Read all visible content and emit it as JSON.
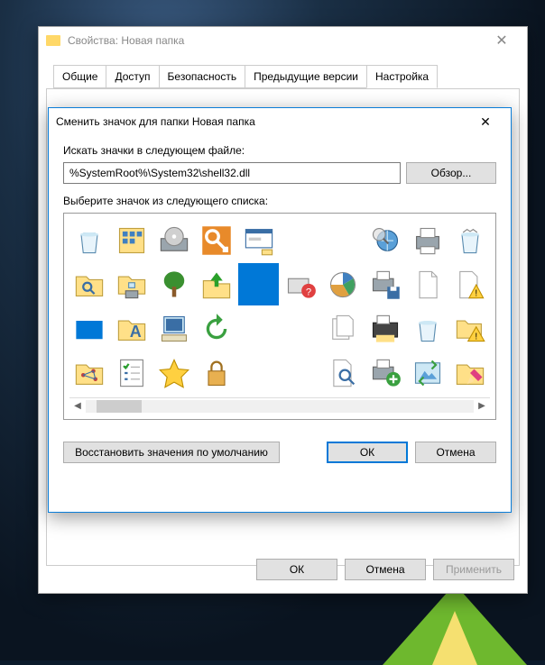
{
  "parent": {
    "title": "Свойства: Новая папка",
    "tabs": [
      "Общие",
      "Доступ",
      "Безопасность",
      "Предыдущие версии",
      "Настройка"
    ],
    "active_tab": 4,
    "buttons": {
      "ok": "ОК",
      "cancel": "Отмена",
      "apply": "Применить"
    }
  },
  "child": {
    "title": "Сменить значок для папки Новая папка",
    "search_label": "Искать значки в следующем файле:",
    "path_value": "%SystemRoot%\\System32\\shell32.dll",
    "browse": "Обзор...",
    "pick_label": "Выберите значок из следующего списка:",
    "buttons": {
      "restore": "Восстановить значения по умолчанию",
      "ok": "ОК",
      "cancel": "Отмена"
    }
  },
  "icons": [
    "recycle-bin-empty",
    "control-panel",
    "drive-cd",
    "key",
    "run-dialog",
    "blank",
    "blank",
    "magnifier-globe",
    "printer",
    "recycle-bin-full",
    "search-folder",
    "network-folder",
    "tree",
    "folder-up",
    "blue-square",
    "help-device",
    "chart",
    "printer-save",
    "document",
    "warning-doc",
    "blue-rect",
    "font-folder",
    "computer",
    "refresh",
    "blank",
    "blank",
    "documents",
    "fax-printer",
    "recycle-bin",
    "warning-folder",
    "network-map",
    "checklist",
    "star",
    "lock",
    "blank",
    "blank",
    "search-doc",
    "printer-add",
    "recycle-image",
    "highlight-folder"
  ],
  "selected_icon_index": 14
}
